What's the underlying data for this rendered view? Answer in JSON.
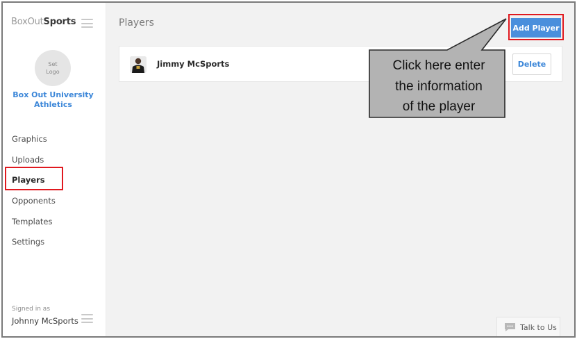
{
  "sidebar": {
    "brand_light": "BoxOut",
    "brand_bold": "Sports",
    "logo_line1": "Set",
    "logo_line2": "Logo",
    "org_line1": "Box Out University",
    "org_line2": "Athletics",
    "nav": [
      {
        "label": "Graphics"
      },
      {
        "label": "Uploads"
      },
      {
        "label": "Players"
      },
      {
        "label": "Opponents"
      },
      {
        "label": "Templates"
      },
      {
        "label": "Settings"
      }
    ],
    "active_item": "Players",
    "signed_in_label": "Signed in as",
    "signed_in_user": "Johnny McSports"
  },
  "main": {
    "title": "Players",
    "add_button": "Add Player",
    "players": [
      {
        "name": "Jimmy McSports",
        "delete_label": "Delete"
      }
    ]
  },
  "callout": {
    "line1": "Click here enter",
    "line2": "the information",
    "line3": "of the player"
  },
  "talk_to_us": "Talk to Us",
  "colors": {
    "accent": "#4a8fdc",
    "link": "#3b86d8",
    "highlight": "#e0191f",
    "callout_fill": "#b3b3b3"
  },
  "icons": {
    "menu": "hamburger-icon",
    "chat": "chat-bubble-icon"
  }
}
